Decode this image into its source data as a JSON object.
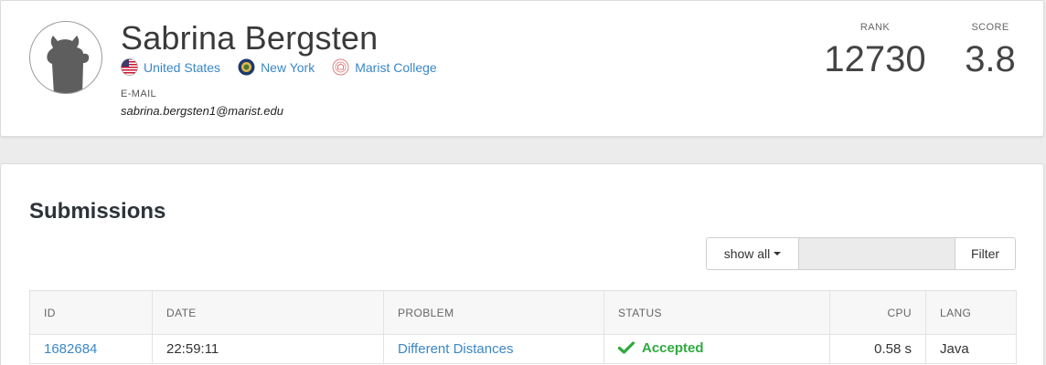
{
  "profile": {
    "name": "Sabrina Bergsten",
    "country": "United States",
    "state": "New York",
    "school": "Marist College",
    "email_label": "E-MAIL",
    "email": "sabrina.bergsten1@marist.edu",
    "rank_label": "RANK",
    "rank": "12730",
    "score_label": "SCORE",
    "score": "3.8"
  },
  "submissions": {
    "title": "Submissions",
    "filter": {
      "show_all_label": "show all",
      "input_value": "",
      "input_placeholder": "",
      "filter_label": "Filter"
    },
    "columns": [
      "ID",
      "DATE",
      "PROBLEM",
      "STATUS",
      "CPU",
      "LANG"
    ],
    "rows": [
      {
        "id": "1682684",
        "date": "22:59:11",
        "problem": "Different Distances",
        "status": "Accepted",
        "cpu": "0.58 s",
        "lang": "Java"
      }
    ]
  },
  "colors": {
    "link": "#3a87c8",
    "accepted": "#2eaa3e",
    "background": "#ececec"
  },
  "icons": [
    "user-avatar-icon",
    "us-flag-icon",
    "new-york-seal-icon",
    "marist-college-logo-icon",
    "checkmark-icon",
    "caret-down-icon"
  ]
}
